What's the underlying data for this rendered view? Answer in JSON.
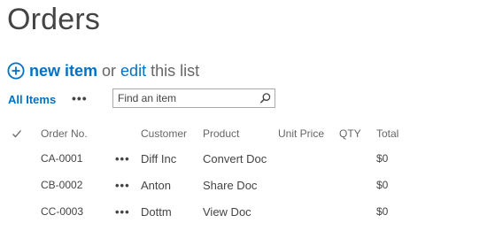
{
  "page": {
    "title": "Orders"
  },
  "actions": {
    "new_item": "new item",
    "or": "or",
    "edit": "edit",
    "this_list": "this list"
  },
  "view": {
    "name": "All Items",
    "more": "•••"
  },
  "search": {
    "placeholder": "Find an item"
  },
  "table": {
    "columns": {
      "order_no": "Order No.",
      "customer": "Customer",
      "product": "Product",
      "unit_price": "Unit Price",
      "qty": "QTY",
      "total": "Total"
    },
    "rows": [
      {
        "order_no": "CA-0001",
        "more": "•••",
        "customer": "Diff Inc",
        "product": "Convert Doc",
        "unit_price": "",
        "qty": "",
        "total": "$0"
      },
      {
        "order_no": "CB-0002",
        "more": "•••",
        "customer": "Anton",
        "product": "Share Doc",
        "unit_price": "",
        "qty": "",
        "total": "$0"
      },
      {
        "order_no": "CC-0003",
        "more": "•••",
        "customer": "Dottm",
        "product": "View Doc",
        "unit_price": "",
        "qty": "",
        "total": "$0"
      }
    ]
  },
  "colors": {
    "link": "#0072c6",
    "text": "#444444",
    "muted": "#666666"
  },
  "icons": {
    "new_item": "plus-circle-icon",
    "search": "search-icon",
    "select_all": "checkmark-icon"
  }
}
